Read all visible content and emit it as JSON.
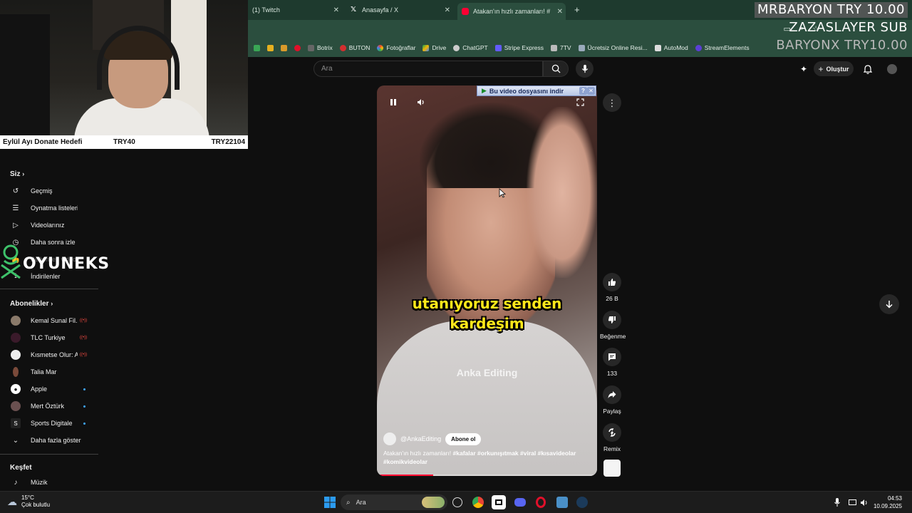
{
  "browser": {
    "tabs": [
      {
        "label": "(1) Twitch",
        "active": false
      },
      {
        "label": "Anasayfa / X",
        "active": false
      },
      {
        "label": "Atakan'ın hızlı zamanları! #",
        "active": true
      }
    ],
    "new_tab": "+",
    "bookmarks": [
      "Botrix",
      "BUTON",
      "Fotoğraflar",
      "Drive",
      "ChatGPT",
      "Stripe Express",
      "7TV",
      "Ücretsiz Online Resi...",
      "AutoMod",
      "StreamElements"
    ]
  },
  "stream_overlay": {
    "line1": "MRBARYON  TRY 10.00",
    "line2": "ZAZASLAYER SUB",
    "line3": "BARYONX  TRY10.00"
  },
  "donate_bar": {
    "label": "Eylül Ayı Donate Hedefi",
    "current": "TRY40",
    "goal": "TRY22104"
  },
  "sidebar": {
    "you_header": "Siz",
    "you_items": [
      "Geçmiş",
      "Oynatma listeleri",
      "Videolarınız",
      "Daha sonra izle",
      "Beğenilen videolar",
      "İndirilenler"
    ],
    "subs_header": "Abonelikler",
    "subs": [
      {
        "name": "Kemal Sunal Fil...",
        "badge": "live"
      },
      {
        "name": "TLC Turkiye",
        "badge": "live"
      },
      {
        "name": "Kısmetse Olur: A...",
        "badge": "live"
      },
      {
        "name": "Talia Mar",
        "badge": ""
      },
      {
        "name": "Apple",
        "badge": "dot"
      },
      {
        "name": "Mert Öztürk",
        "badge": "dot"
      },
      {
        "name": "Sports Digitale",
        "badge": "dot"
      }
    ],
    "show_more": "Daha fazla göster",
    "explore_header": "Keşfet",
    "explore_items": [
      "Müzik"
    ]
  },
  "logo_overlay": "OYUNEKS",
  "youtube": {
    "search_placeholder": "Ara",
    "create_label": "Oluştur"
  },
  "video": {
    "caption_line1": "utanıyoruz senden",
    "caption_line2": "kardeşim",
    "watermark": "Anka Editing",
    "channel": "@AnkaEditing",
    "subscribe_label": "Abone ol",
    "desc_plain": "Atakan'ın hızlı zamanları! ",
    "desc_tags": "#kafalar #orkunışıtmak #viral #kısavideolar #komikvideolar",
    "progress": 0.25,
    "download_banner": "Bu video dosyasını indir"
  },
  "actions": {
    "likes": "26 B",
    "dislike_label": "Beğenme",
    "comments": "133",
    "share_label": "Paylaş",
    "remix_label": "Remix"
  },
  "taskbar": {
    "temp": "15°C",
    "weather": "Çok bulutlu",
    "search_label": "Ara",
    "time": "04:53",
    "date": "10.09.2025"
  }
}
